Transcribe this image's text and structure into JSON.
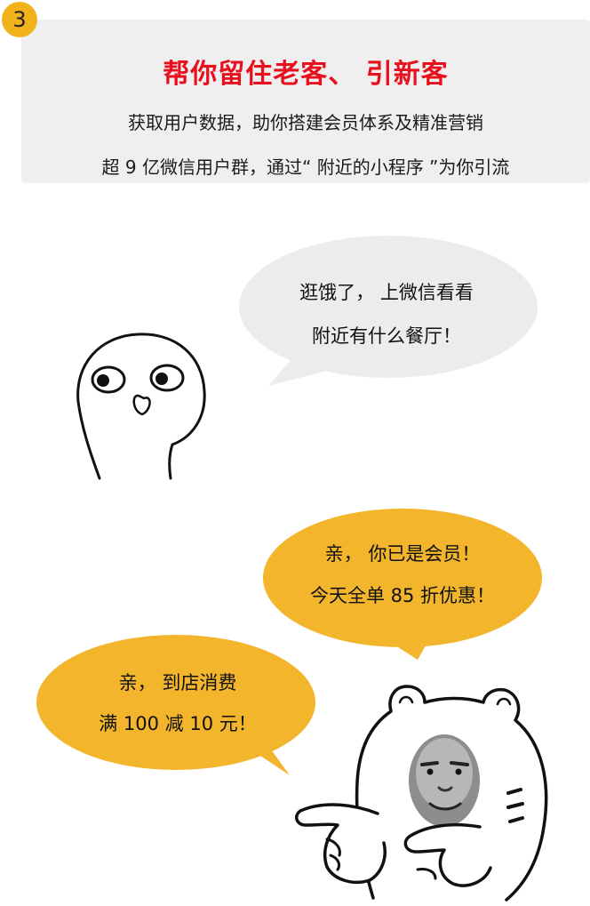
{
  "step_badge": "3",
  "header": {
    "title": "帮你留住老客、 引新客",
    "line1": "获取用户数据，助你搭建会员体系及精准营销",
    "line2": "超 9 亿微信用户群，通过“ 附近的小程序 ”为你引流"
  },
  "bubbles": {
    "customer": {
      "line1": "逛饿了， 上微信看看",
      "line2": "附近有什么餐厅！"
    },
    "member": {
      "line1": "亲， 你已是会员！",
      "line2": "今天全单 85 折优惠！"
    },
    "promo": {
      "line1": "亲， 到店消费",
      "line2": "满 100 减 10 元！"
    }
  },
  "colors": {
    "accent": "#f2b21c",
    "title_red": "#e8101e",
    "card_bg": "#efefef",
    "grey_bubble": "#ececec",
    "yellow_bubble": "#f2b52c"
  }
}
